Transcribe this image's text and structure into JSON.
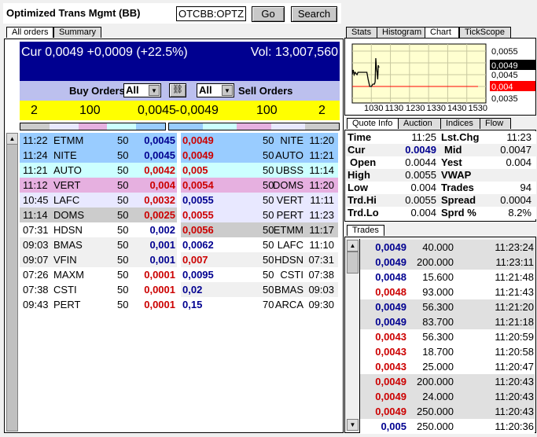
{
  "header": {
    "title": "Optimized Trans Mgmt (BB)",
    "symbol": "OTCBB:OPTZ",
    "go": "Go",
    "search": "Search"
  },
  "left_tabs": [
    "All orders",
    "Summary"
  ],
  "summary": {
    "cur": "Cur 0,0049 +0,0009 (+22.5%)",
    "vol": "Vol: 13,007,560"
  },
  "filters": {
    "buy_label": "Buy Orders",
    "buy_value": "All",
    "sell_label": "Sell Orders",
    "sell_value": "All",
    "link_icon": "chain-link-icon"
  },
  "best": {
    "buy_count": "2",
    "buy_size": "100",
    "buy_price": "0,0045",
    "sep": "-",
    "sell_price": "0,0049",
    "sell_size": "100",
    "sell_count": "2"
  },
  "level_colors": [
    "#cccccc",
    "#e8e8ff",
    "#e6b0e0",
    "#ccffff",
    "#99ccff"
  ],
  "buy_orders": [
    {
      "time": "11:22",
      "mm": "ETMM",
      "size": "50",
      "price": "0,0045",
      "color": "blue",
      "bg": "#99ccff"
    },
    {
      "time": "11:24",
      "mm": "NITE",
      "size": "50",
      "price": "0,0045",
      "color": "blue",
      "bg": "#99ccff"
    },
    {
      "time": "11:21",
      "mm": "AUTO",
      "size": "50",
      "price": "0,0042",
      "color": "red",
      "bg": "#ccffff"
    },
    {
      "time": "11:12",
      "mm": "VERT",
      "size": "50",
      "price": "0,004",
      "color": "red",
      "bg": "#e6b0e0"
    },
    {
      "time": "10:45",
      "mm": "LAFC",
      "size": "50",
      "price": "0,0032",
      "color": "red",
      "bg": "#e8e8ff"
    },
    {
      "time": "11:14",
      "mm": "DOMS",
      "size": "50",
      "price": "0,0025",
      "color": "red",
      "bg": "#cccccc"
    },
    {
      "time": "07:31",
      "mm": "HDSN",
      "size": "50",
      "price": "0,002",
      "color": "blue",
      "bg": "#ffffff"
    },
    {
      "time": "09:03",
      "mm": "BMAS",
      "size": "50",
      "price": "0,001",
      "color": "blue",
      "bg": "#f0f0f0"
    },
    {
      "time": "09:07",
      "mm": "VFIN",
      "size": "50",
      "price": "0,001",
      "color": "blue",
      "bg": "#f0f0f0"
    },
    {
      "time": "07:26",
      "mm": "MAXM",
      "size": "50",
      "price": "0,0001",
      "color": "red",
      "bg": "#ffffff"
    },
    {
      "time": "07:38",
      "mm": "CSTI",
      "size": "50",
      "price": "0,0001",
      "color": "red",
      "bg": "#ffffff"
    },
    {
      "time": "09:43",
      "mm": "PERT",
      "size": "50",
      "price": "0,0001",
      "color": "red",
      "bg": "#ffffff"
    }
  ],
  "sell_orders": [
    {
      "price": "0,0049",
      "size": "50",
      "mm": "NITE",
      "time": "11:20",
      "color": "red",
      "bg": "#99ccff"
    },
    {
      "price": "0,0049",
      "size": "50",
      "mm": "AUTO",
      "time": "11:21",
      "color": "red",
      "bg": "#99ccff"
    },
    {
      "price": "0,005",
      "size": "50",
      "mm": "UBSS",
      "time": "11:14",
      "color": "red",
      "bg": "#ccffff"
    },
    {
      "price": "0,0054",
      "size": "50",
      "mm": "DOMS",
      "time": "11:20",
      "color": "red",
      "bg": "#e6b0e0"
    },
    {
      "price": "0,0055",
      "size": "50",
      "mm": "VERT",
      "time": "11:11",
      "color": "blue",
      "bg": "#e8e8ff"
    },
    {
      "price": "0,0055",
      "size": "50",
      "mm": "PERT",
      "time": "11:23",
      "color": "red",
      "bg": "#e8e8ff"
    },
    {
      "price": "0,0056",
      "size": "50",
      "mm": "ETMM",
      "time": "11:17",
      "color": "red",
      "bg": "#cccccc"
    },
    {
      "price": "0,0062",
      "size": "50",
      "mm": "LAFC",
      "time": "11:10",
      "color": "blue",
      "bg": "#ffffff"
    },
    {
      "price": "0,007",
      "size": "50",
      "mm": "HDSN",
      "time": "07:31",
      "color": "red",
      "bg": "#f0f0f0"
    },
    {
      "price": "0,0095",
      "size": "50",
      "mm": "CSTI",
      "time": "07:38",
      "color": "blue",
      "bg": "#ffffff"
    },
    {
      "price": "0,02",
      "size": "50",
      "mm": "BMAS",
      "time": "09:03",
      "color": "blue",
      "bg": "#f0f0f0"
    },
    {
      "price": "0,15",
      "size": "70",
      "mm": "ARCA",
      "time": "09:30",
      "color": "blue",
      "bg": "#ffffff"
    }
  ],
  "right_tabs": [
    "Stats",
    "Histogram",
    "Chart",
    "TickScope"
  ],
  "chart": {
    "x_ticks": [
      "1030",
      "1130",
      "1230",
      "1330",
      "1430",
      "1530"
    ],
    "y_ticks": [
      "0,0055",
      "0,0045",
      "0,0035"
    ],
    "last_label": "0,0049",
    "prev_close_label": "0,004",
    "ylim": [
      0.0033,
      0.0058
    ],
    "price": [
      [
        0,
        0.0045
      ],
      [
        3,
        0.0047
      ],
      [
        6,
        0.0045
      ],
      [
        9,
        0.0046
      ],
      [
        12,
        0.00455
      ],
      [
        15,
        0.0045
      ],
      [
        18,
        0.0046
      ],
      [
        24,
        0.0046
      ],
      [
        40,
        0.0046
      ],
      [
        46,
        0.0046
      ],
      [
        50,
        0.0043
      ],
      [
        55,
        0.004
      ],
      [
        60,
        0.004
      ],
      [
        65,
        0.0041
      ],
      [
        70,
        0.0041
      ],
      [
        72,
        0.0042
      ],
      [
        74,
        0.0052
      ],
      [
        76,
        0.0048
      ],
      [
        78,
        0.0046
      ],
      [
        80,
        0.0043
      ],
      [
        82,
        0.0049
      ],
      [
        84,
        0.0048
      ]
    ],
    "prev_close": 0.004,
    "colors": {
      "bg": "#ffffd0",
      "prev_close": "#ff0000",
      "line": "#000000"
    }
  },
  "quote_tabs": [
    "Quote Info",
    "Auction",
    "Indices",
    "Flow"
  ],
  "quote": [
    {
      "l1": "Time",
      "v1": "11:25",
      "l2": "Lst.Chg",
      "v2": "11:23"
    },
    {
      "l1": "Cur",
      "v1": "0.0049",
      "l2": "Mid",
      "v2": "0.0047"
    },
    {
      "l1": "Open",
      "v1": "0.0044",
      "l2": "Yest",
      "v2": "0.004"
    },
    {
      "l1": "High",
      "v1": "0.0055",
      "l2": "VWAP",
      "v2": ""
    },
    {
      "l1": "Low",
      "v1": "0.004",
      "l2": "Trades",
      "v2": "94"
    },
    {
      "l1": "Trd.Hi",
      "v1": "0.0055",
      "l2": "Spread",
      "v2": "0.0004"
    },
    {
      "l1": "Trd.Lo",
      "v1": "0.004",
      "l2": "Sprd %",
      "v2": "8.2%"
    }
  ],
  "trades_tab": "Trades",
  "trades": [
    {
      "price": "0,0049",
      "size": "40.000",
      "time": "11:23:24",
      "color": "blue",
      "bg": "#e0e0e0"
    },
    {
      "price": "0,0049",
      "size": "200.000",
      "time": "11:23:11",
      "color": "blue",
      "bg": "#e0e0e0"
    },
    {
      "price": "0,0048",
      "size": "15.600",
      "time": "11:21:48",
      "color": "blue",
      "bg": "#ffffff"
    },
    {
      "price": "0,0048",
      "size": "93.000",
      "time": "11:21:43",
      "color": "red",
      "bg": "#ffffff"
    },
    {
      "price": "0,0049",
      "size": "56.300",
      "time": "11:21:20",
      "color": "blue",
      "bg": "#e0e0e0"
    },
    {
      "price": "0,0049",
      "size": "83.700",
      "time": "11:21:18",
      "color": "blue",
      "bg": "#e0e0e0"
    },
    {
      "price": "0,0043",
      "size": "56.300",
      "time": "11:20:59",
      "color": "red",
      "bg": "#ffffff"
    },
    {
      "price": "0,0043",
      "size": "18.700",
      "time": "11:20:58",
      "color": "red",
      "bg": "#ffffff"
    },
    {
      "price": "0,0043",
      "size": "25.000",
      "time": "11:20:47",
      "color": "red",
      "bg": "#ffffff"
    },
    {
      "price": "0,0049",
      "size": "200.000",
      "time": "11:20:43",
      "color": "red",
      "bg": "#e0e0e0"
    },
    {
      "price": "0,0049",
      "size": "24.000",
      "time": "11:20:43",
      "color": "red",
      "bg": "#e0e0e0"
    },
    {
      "price": "0,0049",
      "size": "250.000",
      "time": "11:20:43",
      "color": "red",
      "bg": "#e0e0e0"
    },
    {
      "price": "0,005",
      "size": "250.000",
      "time": "11:20:36",
      "color": "blue",
      "bg": "#ffffff"
    }
  ]
}
